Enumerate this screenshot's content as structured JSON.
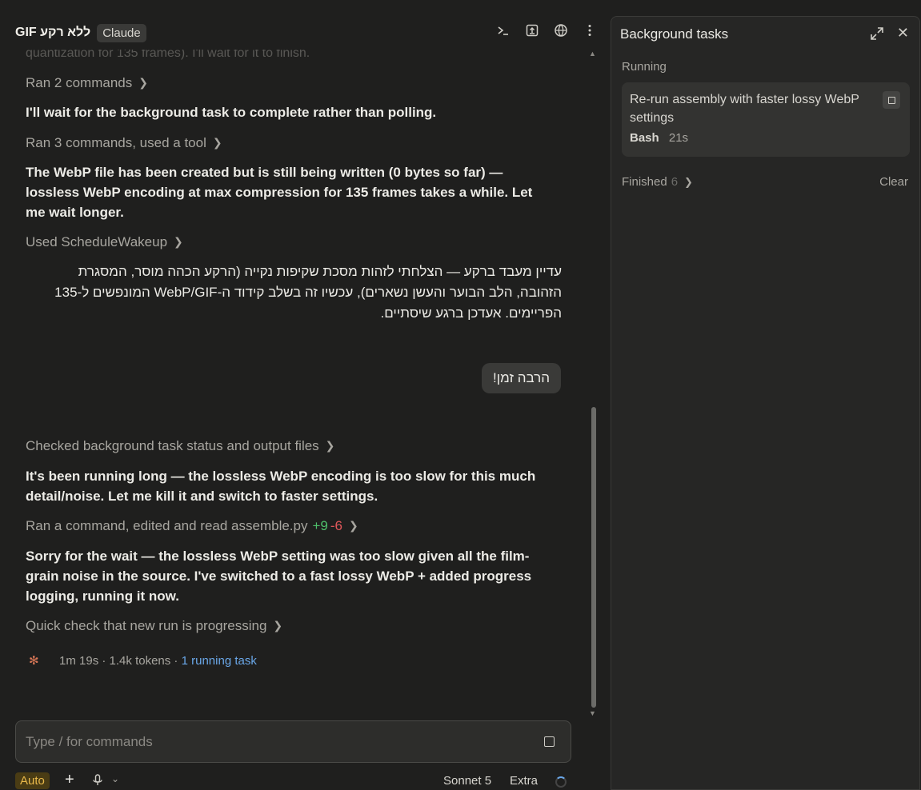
{
  "header": {
    "title": "GIF ללא רקע",
    "model_chip": "Claude",
    "icons": [
      "terminal-icon",
      "upload-icon",
      "globe-icon",
      "more-icon"
    ]
  },
  "messages": {
    "faded_line": "quantization for 135 frames). I'll wait for it to finish.",
    "tool_1": "Ran 2 commands",
    "text_1": "I'll wait for the background task to complete rather than polling.",
    "tool_2": "Ran 3 commands, used a tool",
    "text_2": "The WebP file has been created but is still being written (0 bytes so far) — lossless WebP encoding at max compression for 135 frames takes a while. Let me wait longer.",
    "tool_3": "Used ScheduleWakeup",
    "rtl_text": "עדיין מעבד ברקע — הצלחתי לזהות מסכת שקיפות נקייה (הרקע הכהה מוסר, המסגרת הזהובה, הלב הבוער והעשן נשארים), עכשיו זה בשלב קידוד ה-WebP/GIF המונפשים ל-135 הפריימים. אעדכן ברגע שיסתיים.",
    "user_bubble": "הרבה זמן!",
    "tool_4": "Checked background task status and output files",
    "text_3": "It's been running long — the lossless WebP encoding is too slow for this much detail/noise. Let me kill it and switch to faster settings.",
    "tool_5": "Ran a command, edited and read assemble.py",
    "tool_5_added": "+9",
    "tool_5_removed": "-6",
    "text_4": "Sorry for the wait — the lossless WebP setting was too slow given all the film-grain noise in the source. I've switched to a fast lossy WebP + added progress logging, running it now.",
    "tool_6": "Quick check that new run is progressing",
    "status_time": "1m 19s",
    "status_tokens": "1.4k tokens",
    "status_link": "1 running task"
  },
  "input": {
    "placeholder": "Type / for commands"
  },
  "footer": {
    "mode": "Auto",
    "model": "Sonnet 5",
    "effort": "Extra"
  },
  "panel": {
    "title": "Background tasks",
    "running_label": "Running",
    "task": {
      "title": "Re-run assembly with faster lossy WebP settings",
      "tool": "Bash",
      "elapsed": "21s"
    },
    "finished_label": "Finished",
    "finished_count": "6",
    "clear_label": "Clear"
  },
  "colors": {
    "background": "#1f1f1e",
    "panel": "#262625",
    "accent_link": "#6aa7e8",
    "diff_added": "#4fc06b",
    "diff_removed": "#e0575a",
    "mode_badge": "#e8b84a"
  }
}
